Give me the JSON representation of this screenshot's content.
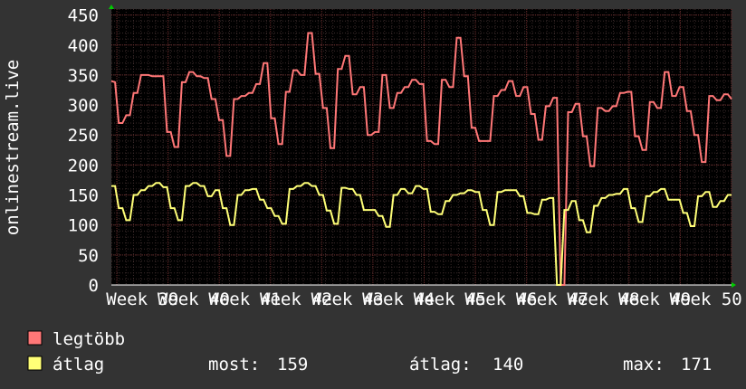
{
  "chart_data": {
    "type": "line",
    "ylabel": "onlinestream.live",
    "ylim": [
      0,
      460
    ],
    "yticks": [
      "0",
      "50",
      "100",
      "150",
      "200",
      "250",
      "300",
      "350",
      "400",
      "450"
    ],
    "xtick_labels": [
      "Week 39",
      "Week 40",
      "Week 41",
      "Week 42",
      "Week 43",
      "Week 44",
      "Week 45",
      "Week 46",
      "Week 47",
      "Week 48",
      "Week 49",
      "Week 50"
    ],
    "background": "#000000",
    "grid": true,
    "x": [
      0,
      1,
      2,
      3,
      4,
      5,
      6,
      7,
      8,
      9,
      10,
      11,
      12,
      13,
      14,
      15,
      16,
      17,
      18,
      19,
      20,
      21,
      22,
      23,
      24,
      25,
      26,
      27,
      28,
      29,
      30,
      31,
      32,
      33,
      34,
      35,
      36,
      37,
      38,
      39,
      40,
      41,
      42,
      43,
      44,
      45,
      46,
      47,
      48,
      49,
      50,
      51,
      52,
      53,
      54,
      55,
      56,
      57,
      58,
      59,
      60,
      61,
      62,
      63,
      64,
      65,
      66,
      67,
      68,
      69,
      70,
      71,
      72,
      73,
      74,
      75,
      76,
      77,
      78,
      79,
      80,
      81,
      82,
      83,
      84,
      85,
      86,
      87,
      88,
      89,
      90,
      91,
      92,
      93,
      94,
      95,
      96,
      97,
      98,
      99,
      100,
      101,
      102,
      103,
      104,
      105,
      106,
      107,
      108,
      109,
      110,
      111,
      112,
      113,
      114,
      115,
      116,
      117,
      118,
      119,
      120,
      121,
      122,
      123,
      124,
      125,
      126,
      127,
      128,
      129,
      130,
      131,
      132,
      133,
      134,
      135,
      136,
      137,
      138,
      139,
      140,
      141,
      142,
      143,
      144,
      145,
      146,
      147,
      148,
      149,
      150,
      151,
      152,
      153,
      154,
      155,
      156,
      157,
      158,
      159,
      160,
      161,
      162,
      163,
      164,
      165,
      166,
      167
    ],
    "series": [
      {
        "name": "legtöbb",
        "color": "#ff7777",
        "values": [
          340,
          338,
          270,
          270,
          283,
          283,
          320,
          320,
          350,
          350,
          350,
          348,
          348,
          348,
          348,
          255,
          255,
          230,
          230,
          338,
          338,
          355,
          355,
          348,
          348,
          345,
          345,
          310,
          310,
          275,
          275,
          215,
          215,
          310,
          310,
          315,
          315,
          320,
          320,
          335,
          335,
          370,
          370,
          278,
          278,
          235,
          235,
          322,
          322,
          358,
          358,
          350,
          350,
          420,
          420,
          352,
          352,
          295,
          295,
          228,
          228,
          360,
          360,
          382,
          382,
          318,
          318,
          330,
          330,
          250,
          250,
          255,
          255,
          350,
          350,
          295,
          295,
          320,
          320,
          330,
          330,
          342,
          342,
          335,
          335,
          240,
          240,
          235,
          235,
          342,
          342,
          330,
          330,
          412,
          412,
          348,
          348,
          262,
          262,
          240,
          240,
          240,
          240,
          315,
          315,
          325,
          325,
          340,
          340,
          315,
          315,
          330,
          330,
          285,
          285,
          242,
          242,
          298,
          298,
          312,
          312,
          0,
          0,
          288,
          288,
          302,
          302,
          248,
          248,
          198,
          198,
          295,
          295,
          290,
          290,
          298,
          298,
          320,
          320,
          322,
          322,
          248,
          248,
          225,
          225,
          305,
          305,
          295,
          295,
          355,
          355,
          315,
          315,
          330,
          330,
          290,
          290,
          250,
          250,
          205,
          205,
          315,
          315,
          308,
          308,
          318,
          318,
          310,
          310,
          305,
          305,
          265,
          265,
          205,
          205,
          318,
          318,
          312,
          312,
          330,
          330,
          305,
          305
        ],
        "color_note": "upper band"
      },
      {
        "name": "átlag",
        "color": "#ffff77",
        "values": [
          165,
          165,
          128,
          128,
          108,
          108,
          150,
          150,
          158,
          158,
          165,
          165,
          170,
          170,
          163,
          163,
          128,
          128,
          108,
          108,
          165,
          165,
          170,
          170,
          165,
          165,
          148,
          148,
          158,
          158,
          128,
          128,
          100,
          100,
          150,
          150,
          158,
          158,
          160,
          160,
          142,
          142,
          128,
          128,
          115,
          115,
          102,
          102,
          160,
          160,
          165,
          165,
          170,
          170,
          165,
          165,
          150,
          150,
          124,
          124,
          102,
          102,
          162,
          162,
          160,
          160,
          150,
          150,
          125,
          125,
          125,
          125,
          115,
          115,
          97,
          97,
          150,
          150,
          160,
          160,
          153,
          153,
          165,
          165,
          160,
          160,
          122,
          122,
          118,
          118,
          140,
          140,
          150,
          150,
          153,
          153,
          158,
          158,
          155,
          155,
          125,
          125,
          100,
          100,
          155,
          155,
          158,
          158,
          158,
          158,
          148,
          148,
          120,
          120,
          118,
          118,
          142,
          142,
          145,
          145,
          0,
          0,
          125,
          125,
          140,
          140,
          108,
          108,
          88,
          88,
          132,
          132,
          145,
          145,
          150,
          150,
          152,
          152,
          160,
          160,
          128,
          128,
          105,
          105,
          148,
          148,
          155,
          155,
          160,
          160,
          142,
          142,
          142,
          142,
          120,
          120,
          98,
          98,
          148,
          148,
          155,
          155,
          130,
          130,
          140,
          140,
          150,
          150,
          157,
          157,
          110,
          110,
          100,
          100,
          150,
          150,
          152,
          152,
          158,
          158,
          158,
          158
        ]
      }
    ]
  },
  "legend": {
    "items": [
      {
        "label": "legtöbb",
        "color": "#ff7777"
      },
      {
        "label": "átlag",
        "color": "#ffff77"
      }
    ],
    "stats": {
      "most_label": "most:",
      "most_value": "159",
      "atlag_label": "átlag:",
      "atlag_value": "140",
      "max_label": "max:",
      "max_value": "171"
    }
  }
}
